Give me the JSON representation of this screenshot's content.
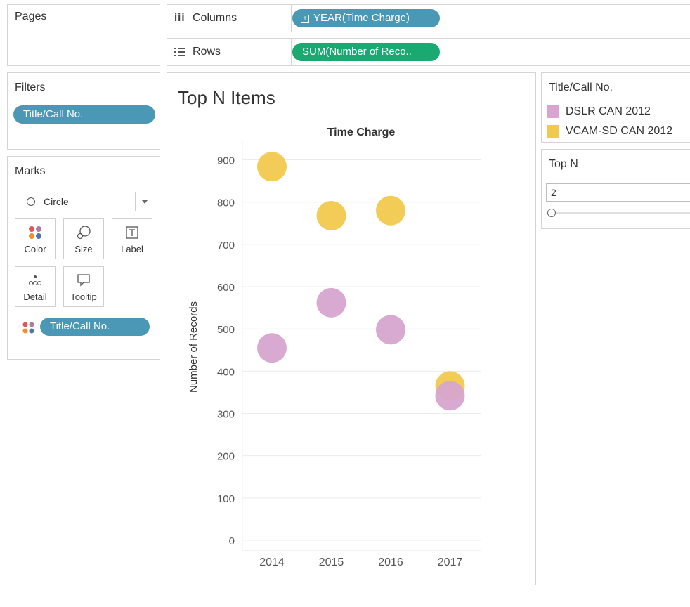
{
  "pages": {
    "title": "Pages"
  },
  "shelves": {
    "columns_label": "Columns",
    "columns_pill": "YEAR(Time Charge)",
    "rows_label": "Rows",
    "rows_pill": "SUM(Number of Reco.."
  },
  "filters": {
    "title": "Filters",
    "pill": "Title/Call No."
  },
  "marks": {
    "title": "Marks",
    "type": "Circle",
    "buttons": {
      "color": "Color",
      "size": "Size",
      "label": "Label",
      "detail": "Detail",
      "tooltip": "Tooltip"
    },
    "color_pill": "Title/Call No."
  },
  "view": {
    "title": "Top N Items"
  },
  "legend": {
    "title": "Title/Call No.",
    "items": [
      {
        "label": "DSLR CAN 2012",
        "color": "#d7a5cf"
      },
      {
        "label": "VCAM-SD CAN 2012",
        "color": "#f1c94e"
      }
    ]
  },
  "topn": {
    "title": "Top N",
    "value": "2"
  },
  "chart_data": {
    "type": "scatter",
    "title": "Time Charge",
    "xlabel": "",
    "ylabel": "Number of Records",
    "categories": [
      "2014",
      "2015",
      "2016",
      "2017"
    ],
    "ylim": [
      0,
      950
    ],
    "yticks": [
      0,
      100,
      200,
      300,
      400,
      500,
      600,
      700,
      800,
      900
    ],
    "series": [
      {
        "name": "VCAM-SD CAN 2012",
        "color": "#f1c94e",
        "values": [
          884,
          768,
          780,
          365
        ]
      },
      {
        "name": "DSLR CAN 2012",
        "color": "#d7a5cf",
        "values": [
          455,
          562,
          498,
          342
        ]
      }
    ]
  }
}
